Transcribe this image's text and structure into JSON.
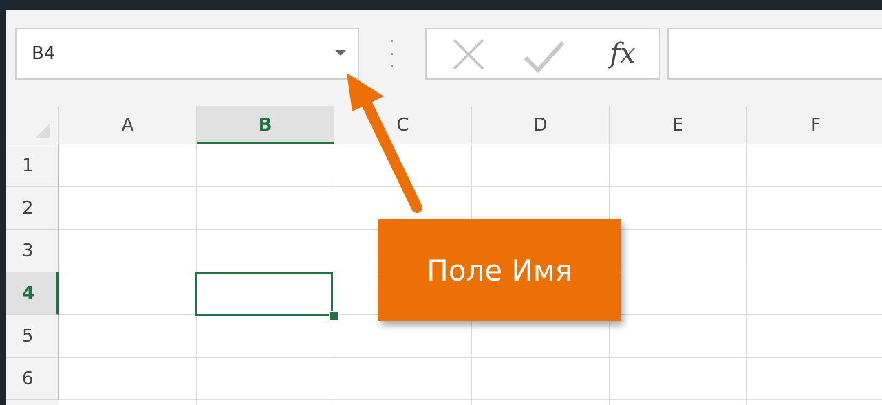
{
  "name_box": {
    "value": "B4"
  },
  "formula_bar": {
    "cancel_icon": "cancel-x-icon",
    "enter_icon": "enter-check-icon",
    "fx_label": "fx",
    "formula_value": ""
  },
  "columns": [
    "A",
    "B",
    "C",
    "D",
    "E",
    "F"
  ],
  "rows": [
    "1",
    "2",
    "3",
    "4",
    "5",
    "6"
  ],
  "selection": {
    "column": "B",
    "row": "4"
  },
  "callout": {
    "label": "Поле Имя"
  },
  "colors": {
    "accent_green": "#217346",
    "callout_orange": "#ec7005",
    "frame_dark": "#1e2630"
  }
}
